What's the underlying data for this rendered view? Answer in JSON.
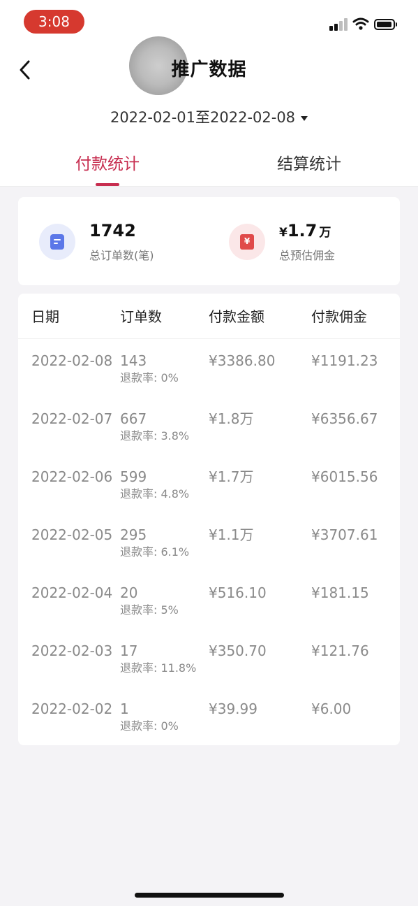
{
  "status_bar": {
    "time": "3:08"
  },
  "header": {
    "title": "推广数据",
    "date_range": "2022-02-01至2022-02-08"
  },
  "tabs": [
    {
      "label": "付款统计",
      "active": true
    },
    {
      "label": "结算统计",
      "active": false
    }
  ],
  "summary": {
    "orders": {
      "value": "1742",
      "label": "总订单数(笔)",
      "icon": "document-icon"
    },
    "commission": {
      "currency": "¥",
      "value": "1.7",
      "unit": "万",
      "label": "总预估佣金",
      "icon": "receipt-icon"
    }
  },
  "table": {
    "headers": [
      "日期",
      "订单数",
      "付款金额",
      "付款佣金"
    ],
    "rows": [
      {
        "date": "2022-02-08",
        "orders": "143",
        "refund": "退款率: 0%",
        "amount": "¥3386.80",
        "commission": "¥1191.23"
      },
      {
        "date": "2022-02-07",
        "orders": "667",
        "refund": "退款率: 3.8%",
        "amount": "¥1.8万",
        "commission": "¥6356.67"
      },
      {
        "date": "2022-02-06",
        "orders": "599",
        "refund": "退款率: 4.8%",
        "amount": "¥1.7万",
        "commission": "¥6015.56"
      },
      {
        "date": "2022-02-05",
        "orders": "295",
        "refund": "退款率: 6.1%",
        "amount": "¥1.1万",
        "commission": "¥3707.61"
      },
      {
        "date": "2022-02-04",
        "orders": "20",
        "refund": "退款率: 5%",
        "amount": "¥516.10",
        "commission": "¥181.15"
      },
      {
        "date": "2022-02-03",
        "orders": "17",
        "refund": "退款率: 11.8%",
        "amount": "¥350.70",
        "commission": "¥121.76"
      },
      {
        "date": "2022-02-02",
        "orders": "1",
        "refund": "退款率: 0%",
        "amount": "¥39.99",
        "commission": "¥6.00"
      }
    ]
  },
  "colors": {
    "accent": "#c72d4f",
    "status_pill": "#d6392f",
    "blue_icon": "#5b77e8",
    "red_icon": "#e04a4a"
  }
}
